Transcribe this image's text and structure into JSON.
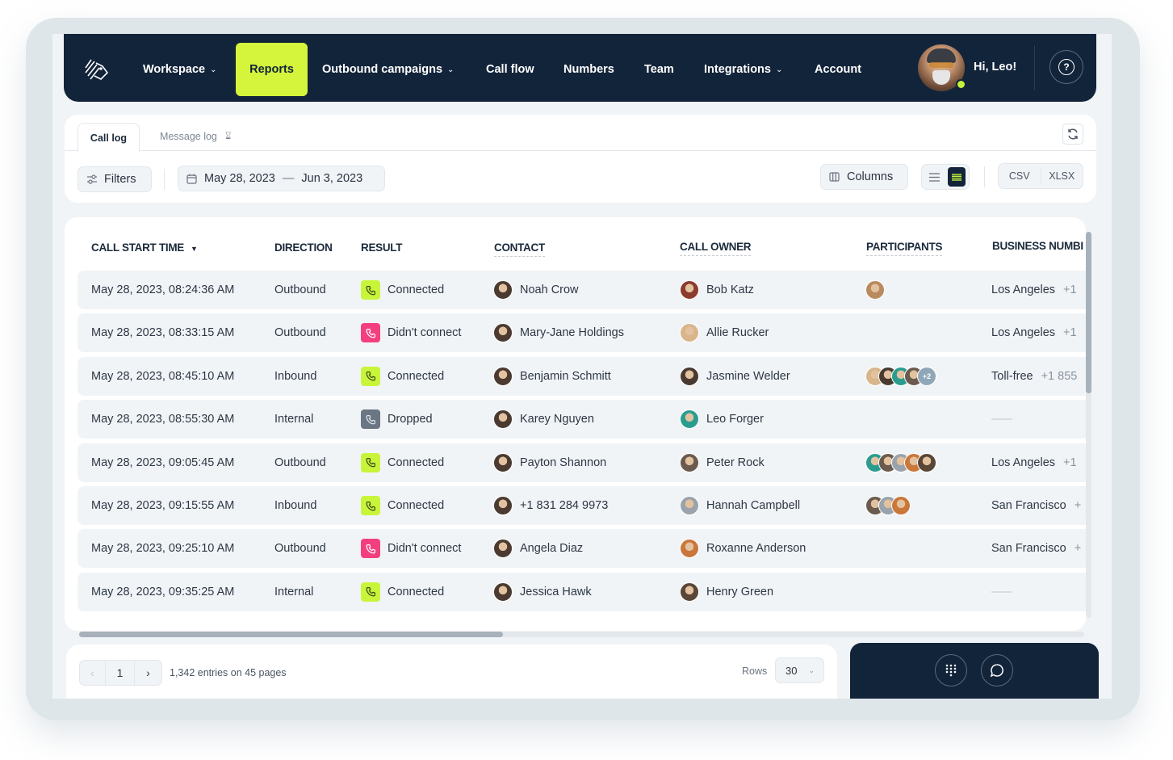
{
  "nav": {
    "items": [
      {
        "label": "Workspace",
        "has_dropdown": true,
        "active": false
      },
      {
        "label": "Reports",
        "has_dropdown": false,
        "active": true
      },
      {
        "label": "Outbound campaigns",
        "has_dropdown": true,
        "active": false
      },
      {
        "label": "Call flow",
        "has_dropdown": false,
        "active": false
      },
      {
        "label": "Numbers",
        "has_dropdown": false,
        "active": false
      },
      {
        "label": "Team",
        "has_dropdown": false,
        "active": false
      },
      {
        "label": "Integrations",
        "has_dropdown": true,
        "active": false
      },
      {
        "label": "Account",
        "has_dropdown": false,
        "active": false
      }
    ],
    "greeting": "Hi, Leo!",
    "user_status": "online",
    "help_icon": "?"
  },
  "colors": {
    "nav_bg": "#12243a",
    "accent": "#d4f53c",
    "connected": "#c8f53a",
    "didnt_connect": "#f43f7e",
    "dropped": "#6b7684"
  },
  "tabs": [
    {
      "label": "Call log",
      "active": true
    },
    {
      "label": "Message log",
      "active": false,
      "icon": "hourglass-icon"
    }
  ],
  "toolbar": {
    "filters_label": "Filters",
    "date_from": "May 28, 2023",
    "date_separator": "—",
    "date_to": "Jun 3, 2023",
    "columns_label": "Columns",
    "view_mode": "compact",
    "export_csv": "CSV",
    "export_xlsx": "XLSX"
  },
  "table": {
    "columns": [
      "CALL START TIME",
      "DIRECTION",
      "RESULT",
      "CONTACT",
      "CALL OWNER",
      "PARTICIPANTS",
      "BUSINESS NUMBI"
    ],
    "sort_indicator": "▼",
    "rows": [
      {
        "time": "May 28, 2023, 08:24:36 AM",
        "direction": "Outbound",
        "result": "Connected",
        "result_type": "connected",
        "contact": "Noah Crow",
        "owner": "Bob Katz",
        "participants": 1,
        "participants_more": "",
        "business": "Los Angeles",
        "business_extra": "+1"
      },
      {
        "time": "May 28, 2023, 08:33:15 AM",
        "direction": "Outbound",
        "result": "Didn't connect",
        "result_type": "failed",
        "contact": "Mary-Jane Holdings",
        "owner": "Allie Rucker",
        "participants": 0,
        "participants_more": "",
        "business": "Los Angeles",
        "business_extra": "+1"
      },
      {
        "time": "May 28, 2023, 08:45:10 AM",
        "direction": "Inbound",
        "result": "Connected",
        "result_type": "connected",
        "contact": "Benjamin Schmitt",
        "owner": "Jasmine Welder",
        "participants": 4,
        "participants_more": "+2",
        "business": "Toll-free",
        "business_extra": "+1 855"
      },
      {
        "time": "May 28, 2023, 08:55:30 AM",
        "direction": "Internal",
        "result": "Dropped",
        "result_type": "dropped",
        "contact": "Karey Nguyen",
        "owner": "Leo Forger",
        "participants": 0,
        "participants_more": "",
        "business": "",
        "business_extra": ""
      },
      {
        "time": "May 28, 2023, 09:05:45 AM",
        "direction": "Outbound",
        "result": "Connected",
        "result_type": "connected",
        "contact": "Payton Shannon",
        "owner": "Peter Rock",
        "participants": 5,
        "participants_more": "",
        "business": "Los Angeles",
        "business_extra": "+1"
      },
      {
        "time": "May 28, 2023, 09:15:55 AM",
        "direction": "Inbound",
        "result": "Connected",
        "result_type": "connected",
        "contact": "+1 831 284 9973",
        "owner": "Hannah Campbell",
        "participants": 3,
        "participants_more": "",
        "business": "San Francisco",
        "business_extra": "+"
      },
      {
        "time": "May 28, 2023, 09:25:10 AM",
        "direction": "Outbound",
        "result": "Didn't connect",
        "result_type": "failed",
        "contact": "Angela Diaz",
        "owner": "Roxanne Anderson",
        "participants": 0,
        "participants_more": "",
        "business": "San Francisco",
        "business_extra": "+"
      },
      {
        "time": "May 28, 2023, 09:35:25 AM",
        "direction": "Internal",
        "result": "Connected",
        "result_type": "connected",
        "contact": "Jessica Hawk",
        "owner": "Henry Green",
        "participants": 0,
        "participants_more": "",
        "business": "",
        "business_extra": ""
      }
    ]
  },
  "pagination": {
    "current_page": "1",
    "summary": "1,342 entries on 45 pages",
    "rows_label": "Rows",
    "rows_value": "30"
  },
  "dock": {
    "buttons": [
      "dialpad-icon",
      "chat-icon"
    ]
  }
}
